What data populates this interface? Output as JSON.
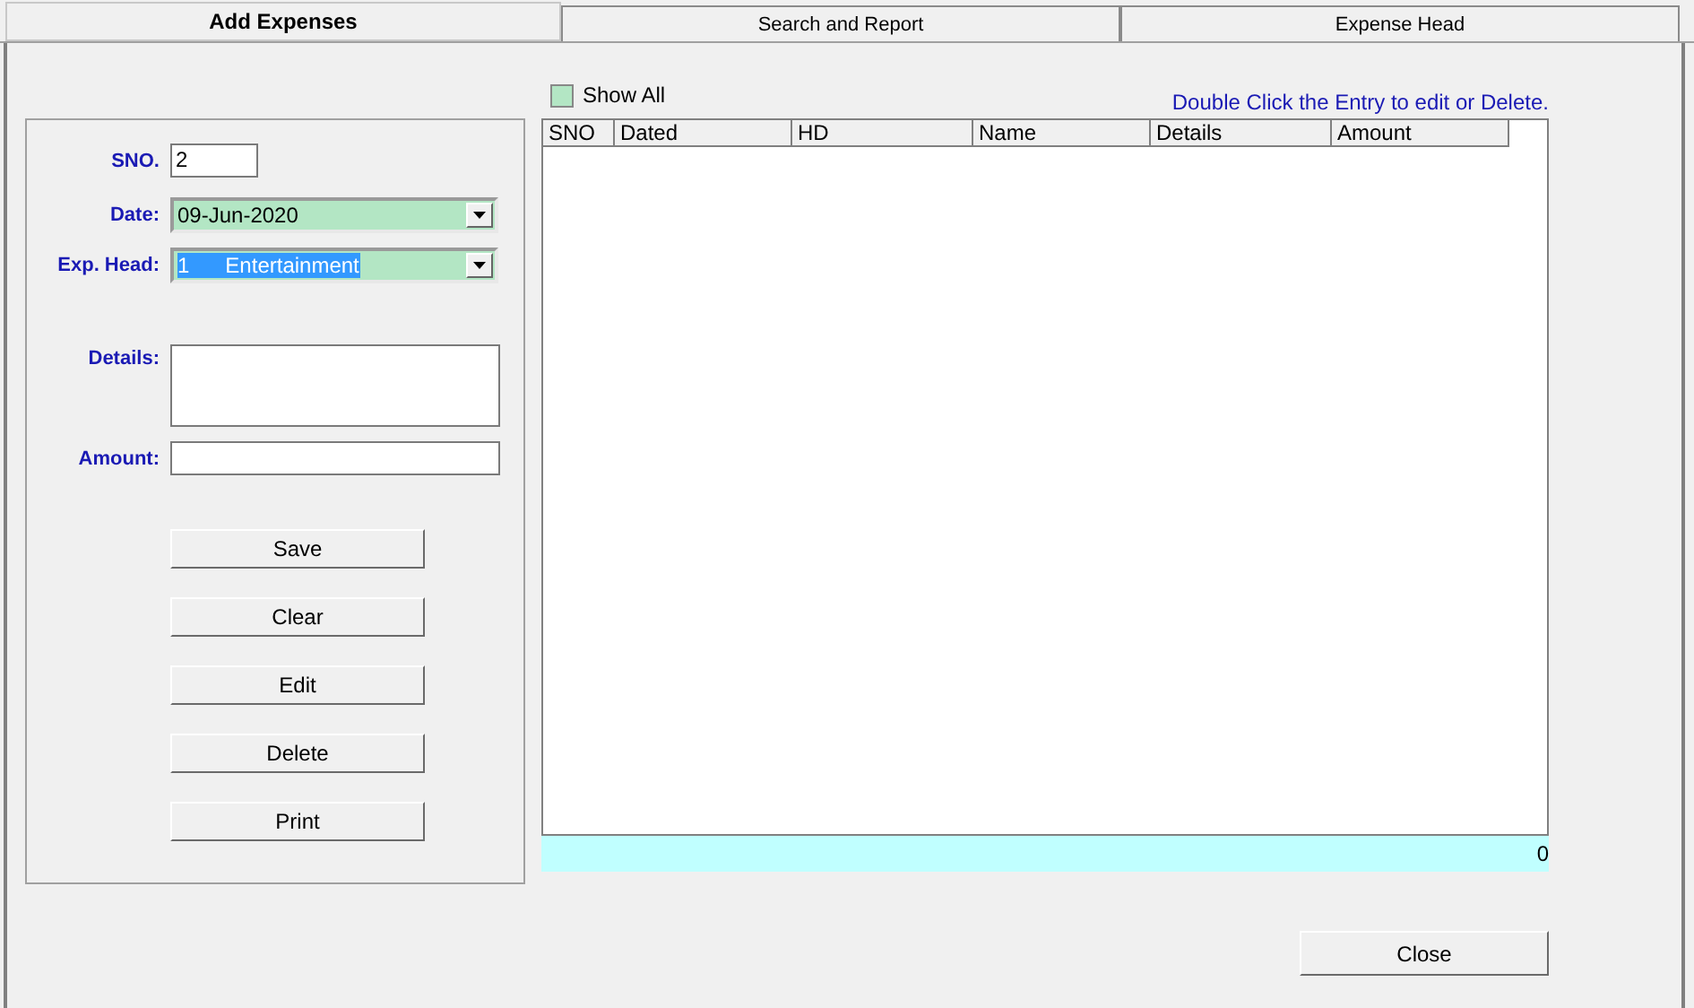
{
  "tabs": [
    {
      "label": "Add Expenses",
      "selected": true
    },
    {
      "label": "Search and Report",
      "selected": false
    },
    {
      "label": "Expense Head",
      "selected": false
    }
  ],
  "form": {
    "sno": {
      "label": "SNO.",
      "value": "2"
    },
    "date": {
      "label": "Date:",
      "value": "09-Jun-2020"
    },
    "exp_head": {
      "label": "Exp. Head:",
      "value": "1      Entertainment"
    },
    "details": {
      "label": "Details:"
    },
    "amount": {
      "label": "Amount:"
    },
    "buttons": [
      "Save",
      "Clear",
      "Edit",
      "Delete",
      "Print"
    ]
  },
  "show_all": {
    "label": "Show All",
    "checked": false
  },
  "hint": "Double Click the Entry to edit or Delete.",
  "table": {
    "columns": [
      "SNO",
      "Dated",
      "HD",
      "Name",
      "Details",
      "Amount"
    ]
  },
  "total": "0",
  "close_button": "Close"
}
